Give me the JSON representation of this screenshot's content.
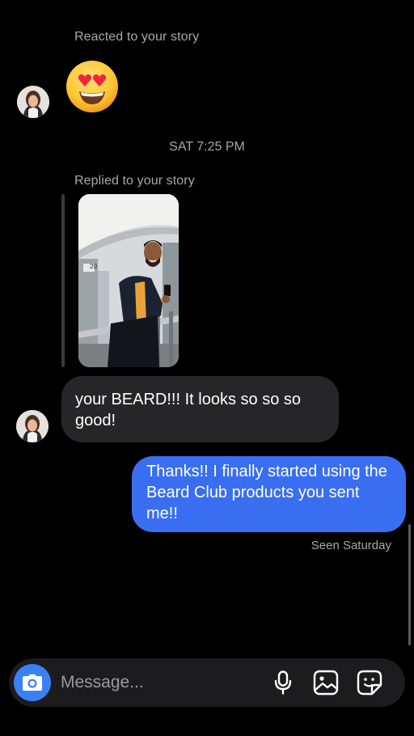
{
  "thread": {
    "reaction_label": "Reacted to your story",
    "reaction_emoji": "heart-eyes-emoji",
    "timestamp": "SAT 7:25 PM",
    "reply_label": "Replied to your story",
    "incoming_message": "your BEARD!!! It looks so so so good!",
    "outgoing_message": "Thanks!! I finally started using the Beard Club products you sent me!!",
    "seen_status": "Seen Saturday"
  },
  "composer": {
    "placeholder": "Message...",
    "icons": [
      "camera-icon",
      "microphone-icon",
      "gallery-icon",
      "sticker-icon"
    ]
  },
  "colors": {
    "background": "#000000",
    "incoming_bubble": "#262628",
    "outgoing_bubble": "#3a6ef0",
    "camera_button": "#3a80f5",
    "secondary_text": "#a8a8a8"
  }
}
